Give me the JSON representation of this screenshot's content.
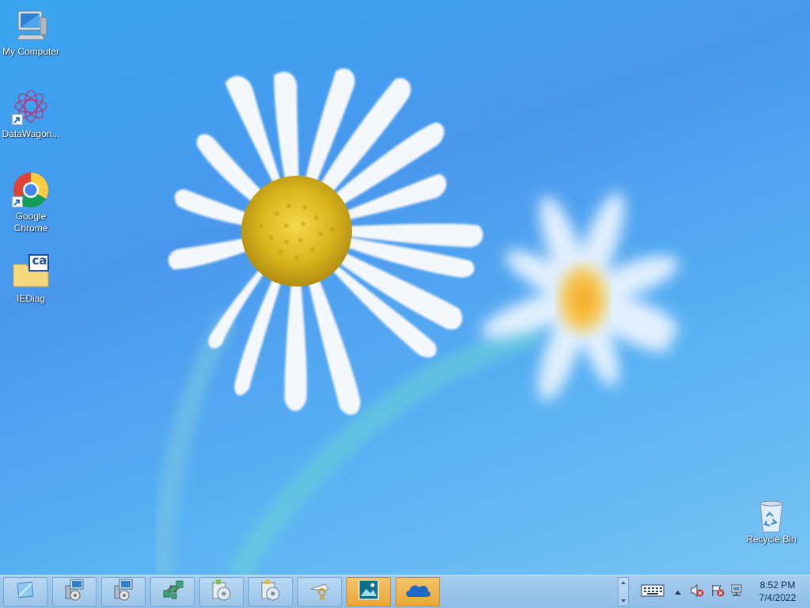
{
  "desktop": {
    "icons": [
      {
        "label": "My Computer",
        "icon": "my-computer-icon"
      },
      {
        "label": "DataWagon...",
        "icon": "datawagon-icon"
      },
      {
        "label": "Google Chrome",
        "icon": "chrome-icon"
      },
      {
        "label": "IEDiag",
        "icon": "iediag-icon"
      },
      {
        "label": "Recycle Bin",
        "icon": "recycle-bin-icon"
      }
    ],
    "iediag_badge": "ca"
  },
  "taskbar": {
    "buttons": [
      {
        "icon": "start-app-icon"
      },
      {
        "icon": "remote-desktop-icon"
      },
      {
        "icon": "remote-desktop-2-icon"
      },
      {
        "icon": "network-icon"
      },
      {
        "icon": "installer-icon"
      },
      {
        "icon": "installer-2-icon"
      },
      {
        "icon": "key-tool-icon"
      },
      {
        "icon": "photo-app-icon",
        "active": true
      },
      {
        "icon": "onedrive-icon",
        "active": true
      }
    ],
    "tray": {
      "icons": [
        "keyboard-icon",
        "show-hidden-icons-icon",
        "volume-muted-icon",
        "action-center-flag-icon",
        "network-status-icon"
      ]
    },
    "clock": {
      "time": "8:52 PM",
      "date": "7/4/2022"
    }
  },
  "colors": {
    "accent": "#f0a93a",
    "taskbar": "#9cc5ea"
  }
}
